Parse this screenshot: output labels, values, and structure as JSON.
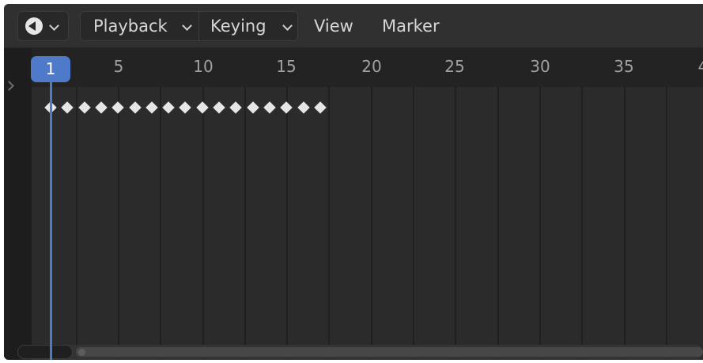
{
  "header": {
    "editor_type_icon": "clock-icon",
    "menus": {
      "playback": "Playback",
      "keying": "Keying",
      "view": "View",
      "marker": "Marker"
    }
  },
  "timeline": {
    "current_frame": "1",
    "ruler_labels": [
      "5",
      "10",
      "15",
      "20",
      "25",
      "30",
      "35",
      "4"
    ],
    "keyframe_count": 17,
    "colors": {
      "playhead": "#4f7ac9",
      "keyframe": "#e6e6e6",
      "background": "#2b2b2b"
    }
  }
}
